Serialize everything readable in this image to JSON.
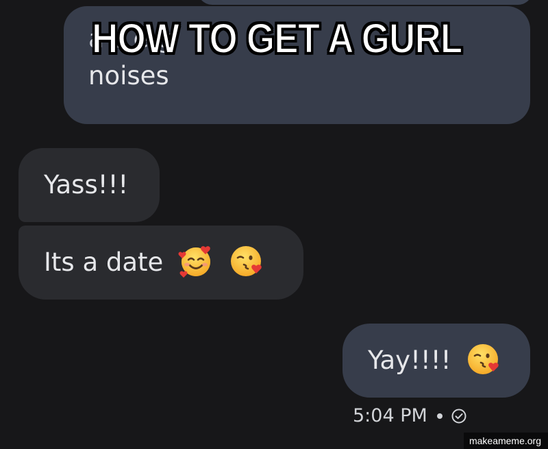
{
  "meme": {
    "caption": "HOW TO GET A GURL",
    "watermark": "makeameme.org"
  },
  "messages": [
    {
      "direction": "sent",
      "text_partial_hidden": "a  s  e  g",
      "text": "noises"
    },
    {
      "direction": "received",
      "text": "Yass!!!"
    },
    {
      "direction": "received",
      "text": "Its a date",
      "emojis": [
        "smiling-face-with-hearts",
        "face-blowing-a-kiss"
      ]
    },
    {
      "direction": "sent",
      "text": "Yay!!!!",
      "emojis": [
        "face-blowing-a-kiss"
      ]
    }
  ],
  "status": {
    "time": "5:04 PM",
    "delivery_icon": "check-circle-icon"
  },
  "colors": {
    "background": "#171719",
    "sent_bubble": "#373d4b",
    "received_bubble": "#2a2b2f",
    "text": "#e6e7ea"
  }
}
